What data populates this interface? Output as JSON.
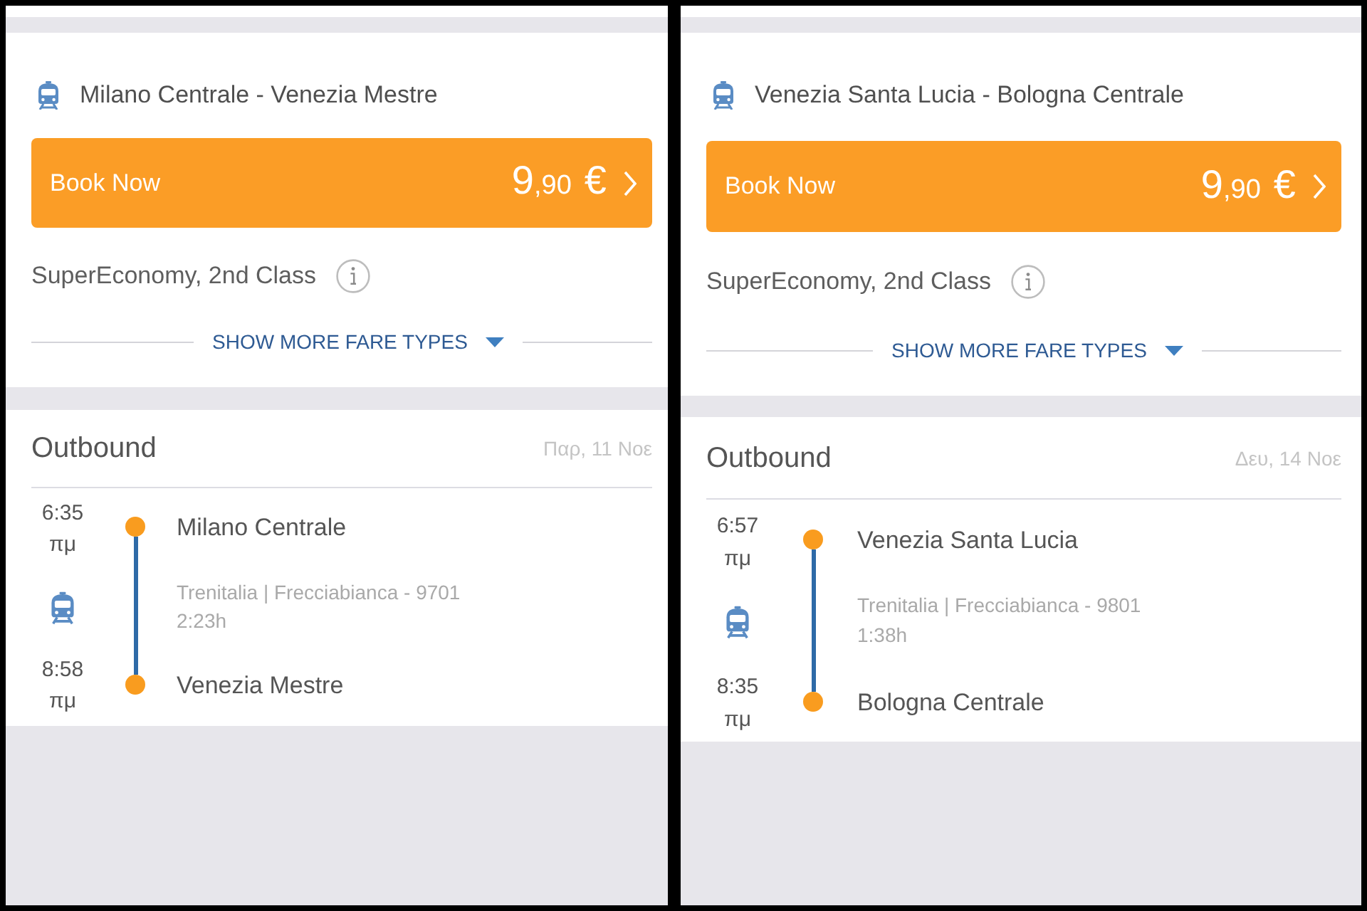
{
  "panels": [
    {
      "route": "Milano Centrale - Venezia Mestre",
      "book_button": {
        "label": "Book Now",
        "price_whole": "9",
        "price_fraction": ",90",
        "currency": "€"
      },
      "fare": "SuperEconomy, 2nd Class",
      "more_fares": {
        "label": "SHOW MORE FARE TYPES",
        "expanded": false
      },
      "outbound": {
        "title": "Outbound",
        "date": "Παρ, 11 Νοε",
        "departure": {
          "time": "6:35",
          "period": "πμ",
          "station": "Milano Centrale"
        },
        "operator": "Trenitalia | Frecciabianca - 9701",
        "duration": "2:23h",
        "arrival": {
          "time": "8:58",
          "period": "πμ",
          "station": "Venezia Mestre"
        }
      }
    },
    {
      "route": "Venezia Santa Lucia - Bologna Centrale",
      "book_button": {
        "label": "Book Now",
        "price_whole": "9",
        "price_fraction": ",90",
        "currency": "€"
      },
      "fare": "SuperEconomy, 2nd Class",
      "more_fares": {
        "label": "SHOW MORE FARE TYPES",
        "expanded": false
      },
      "outbound": {
        "title": "Outbound",
        "date": "Δευ, 14 Νοε",
        "departure": {
          "time": "6:57",
          "period": "πμ",
          "station": "Venezia Santa Lucia"
        },
        "operator": "Trenitalia | Frecciabianca - 9801",
        "duration": "1:38h",
        "arrival": {
          "time": "8:35",
          "period": "πμ",
          "station": "Bologna Centrale"
        }
      }
    }
  ]
}
